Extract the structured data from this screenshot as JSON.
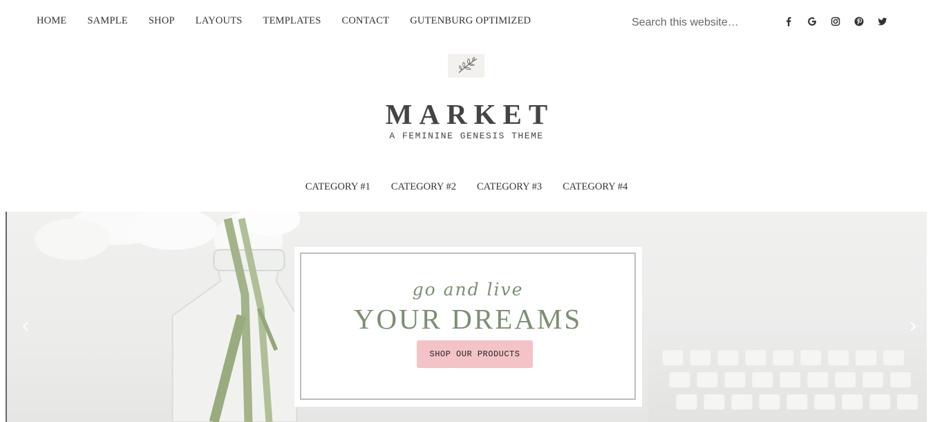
{
  "nav": {
    "items": [
      "HOME",
      "SAMPLE",
      "SHOP",
      "LAYOUTS",
      "TEMPLATES",
      "CONTACT",
      "GUTENBURG OPTIMIZED"
    ]
  },
  "search": {
    "placeholder": "Search this website…",
    "value": ""
  },
  "social": [
    "facebook-icon",
    "google-icon",
    "instagram-icon",
    "pinterest-icon",
    "twitter-icon"
  ],
  "site": {
    "title": "MARKET",
    "tagline": "A FEMININE GENESIS THEME"
  },
  "categories": [
    "CATEGORY #1",
    "CATEGORY #2",
    "CATEGORY #3",
    "CATEGORY #4"
  ],
  "hero": {
    "script_line": "go and live",
    "headline": "YOUR DREAMS",
    "cta_label": "SHOP OUR PRODUCTS"
  },
  "colors": {
    "accent_green": "#7d8e74",
    "button_pink": "#f3c3c8",
    "text": "#333333"
  }
}
